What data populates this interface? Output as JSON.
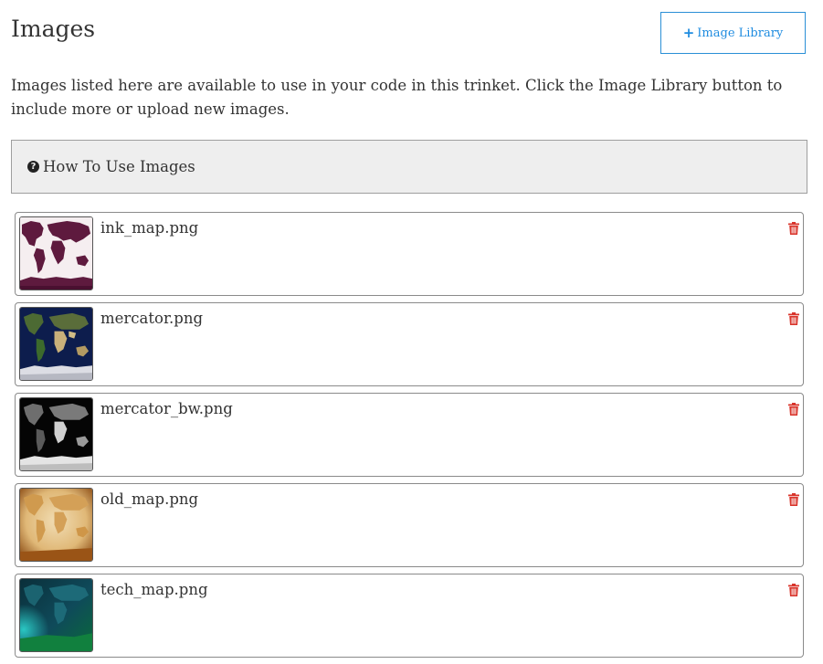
{
  "header": {
    "title": "Images",
    "library_button": {
      "icon": "plus-icon",
      "icon_glyph": "+",
      "label": "Image Library"
    }
  },
  "intro_text": "Images listed here are available to use in your code in this trinket. Click the Image Library button to include more or upload new images.",
  "howto": {
    "icon": "question-circle-icon",
    "icon_glyph": "?",
    "label": "How To Use Images"
  },
  "images": [
    {
      "filename": "ink_map.png",
      "thumbnail": "ink-map-thumbnail",
      "delete_icon": "trash-icon"
    },
    {
      "filename": "mercator.png",
      "thumbnail": "mercator-thumbnail",
      "delete_icon": "trash-icon"
    },
    {
      "filename": "mercator_bw.png",
      "thumbnail": "mercator-bw-thumbnail",
      "delete_icon": "trash-icon"
    },
    {
      "filename": "old_map.png",
      "thumbnail": "old-map-thumbnail",
      "delete_icon": "trash-icon"
    },
    {
      "filename": "tech_map.png",
      "thumbnail": "tech-map-thumbnail",
      "delete_icon": "trash-icon"
    }
  ],
  "colors": {
    "accent_blue": "#1f8ce0",
    "delete_red": "#d9342b",
    "howto_background": "#eeeeee"
  }
}
